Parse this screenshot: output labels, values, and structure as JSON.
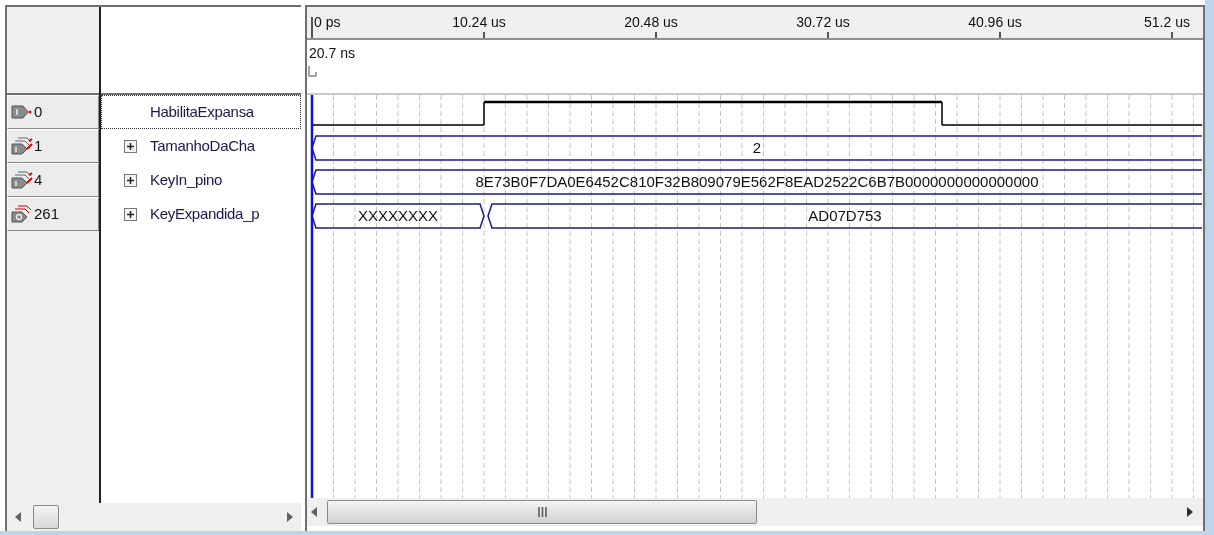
{
  "time_ruler": {
    "ticks": [
      "0 ps",
      "10.24 us",
      "20.48 us",
      "30.72 us",
      "40.96 us",
      "51.2 us"
    ]
  },
  "cursor": {
    "label": "20.7 ns"
  },
  "signals": [
    {
      "value": "0",
      "kind": "input_pin",
      "expandable": false,
      "focused": true,
      "name": "HabilitaExpansa",
      "segments": [
        {
          "high": false
        },
        {
          "high": true
        },
        {
          "high": false
        }
      ]
    },
    {
      "value": "1",
      "kind": "input_bus",
      "expandable": true,
      "focused": false,
      "name": "TamanhoDaCha",
      "segments": [
        {
          "label": "2"
        }
      ]
    },
    {
      "value": "4",
      "kind": "input_bus",
      "expandable": true,
      "focused": false,
      "name": "KeyIn_pino",
      "segments": [
        {
          "label": "8E73B0F7DA0E6452C810F32B809079E562F8EAD2522C6B7B0000000000000000"
        }
      ]
    },
    {
      "value": "261",
      "kind": "output_bus",
      "expandable": true,
      "focused": false,
      "name": "KeyExpandida_p",
      "segments": [
        {
          "label": "XXXXXXXX"
        },
        {
          "label": "AD07D753"
        }
      ]
    }
  ]
}
